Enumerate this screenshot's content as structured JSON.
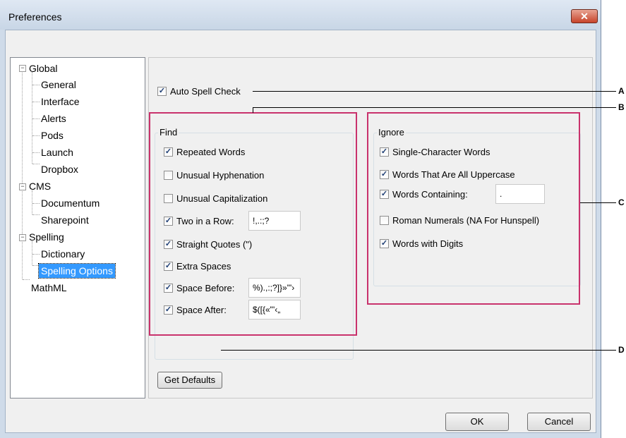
{
  "window": {
    "title": "Preferences",
    "close_symbol": "✕"
  },
  "tree": {
    "items": [
      {
        "label": "Global",
        "expander": "−"
      },
      {
        "label": "General"
      },
      {
        "label": "Interface"
      },
      {
        "label": "Alerts"
      },
      {
        "label": "Pods"
      },
      {
        "label": "Launch"
      },
      {
        "label": "Dropbox"
      },
      {
        "label": "CMS",
        "expander": "−"
      },
      {
        "label": "Documentum"
      },
      {
        "label": "Sharepoint"
      },
      {
        "label": "Spelling",
        "expander": "−"
      },
      {
        "label": "Dictionary"
      },
      {
        "label": "Spelling Options",
        "selected": true
      },
      {
        "label": "MathML"
      }
    ]
  },
  "auto_spell_check": {
    "label": "Auto Spell Check",
    "checked": true
  },
  "find": {
    "title": "Find",
    "options": [
      {
        "label": "Repeated Words",
        "checked": true
      },
      {
        "label": "Unusual Hyphenation",
        "checked": false
      },
      {
        "label": "Unusual Capitalization",
        "checked": false
      },
      {
        "label": "Two in a Row:",
        "checked": true,
        "value": "!,.:;?"
      },
      {
        "label": "Straight Quotes (\")",
        "checked": true
      },
      {
        "label": "Extra Spaces",
        "checked": true
      },
      {
        "label": "Space Before:",
        "checked": true,
        "value": "%).,:;?]}»\"'›"
      },
      {
        "label": "Space After:",
        "checked": true,
        "value": "$([{«\"'‹„"
      }
    ]
  },
  "ignore": {
    "title": "Ignore",
    "options": [
      {
        "label": "Single-Character Words",
        "checked": true
      },
      {
        "label": "Words That Are All Uppercase",
        "checked": true
      },
      {
        "label": "Words Containing:",
        "checked": true,
        "value": "."
      },
      {
        "label": "Roman Numerals (NA For Hunspell)",
        "checked": false
      },
      {
        "label": "Words with Digits",
        "checked": true
      }
    ]
  },
  "buttons": {
    "get_defaults": "Get Defaults",
    "ok": "OK",
    "cancel": "Cancel"
  },
  "callouts": [
    "A",
    "B",
    "C",
    "D"
  ],
  "check_symbol": "✓",
  "colors": {
    "highlight_box": "#c9326c",
    "selection": "#3399ff"
  }
}
